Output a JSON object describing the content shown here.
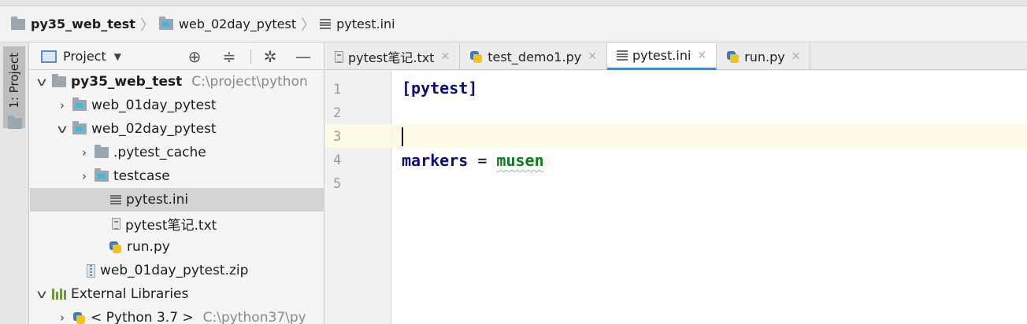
{
  "breadcrumb": [
    {
      "label": "py35_web_test",
      "icon": "folder-icon"
    },
    {
      "label": "web_02day_pytest",
      "icon": "module-folder-icon"
    },
    {
      "label": "pytest.ini",
      "icon": "ini-file-icon"
    }
  ],
  "left_strip": {
    "project_tab_label": "1: Project"
  },
  "project_panel": {
    "title": "Project"
  },
  "tree": [
    {
      "label": "py35_web_test",
      "path": "C:\\project\\python",
      "bold": true,
      "expanded": true,
      "icon": "folder-icon"
    },
    {
      "label": "web_01day_pytest",
      "expanded": false,
      "icon": "module-folder-icon"
    },
    {
      "label": "web_02day_pytest",
      "expanded": true,
      "icon": "module-folder-icon"
    },
    {
      "label": ".pytest_cache",
      "expanded": false,
      "icon": "folder-icon"
    },
    {
      "label": "testcase",
      "expanded": false,
      "icon": "module-folder-icon"
    },
    {
      "label": "pytest.ini",
      "icon": "ini-file-icon",
      "selected": true
    },
    {
      "label": "pytest笔记.txt",
      "icon": "text-file-icon"
    },
    {
      "label": "run.py",
      "icon": "python-file-icon"
    },
    {
      "label": "web_01day_pytest.zip",
      "icon": "zip-file-icon"
    },
    {
      "label": "External Libraries",
      "expanded": true,
      "icon": "library-icon"
    },
    {
      "label": "< Python 3.7 >",
      "path": "C:\\python37\\py",
      "expanded": false,
      "icon": "python-icon"
    }
  ],
  "tabs": [
    {
      "label": "pytest笔记.txt",
      "icon": "text-file-icon",
      "active": false
    },
    {
      "label": "test_demo1.py",
      "icon": "python-file-icon",
      "active": false
    },
    {
      "label": "pytest.ini",
      "icon": "ini-file-icon",
      "active": true
    },
    {
      "label": "run.py",
      "icon": "python-file-icon",
      "active": false
    }
  ],
  "editor": {
    "line_numbers": [
      "1",
      "2",
      "3",
      "4",
      "5"
    ],
    "current_line": 3,
    "code": {
      "line1": "[pytest]",
      "line4_key": "markers",
      "line4_eq": " = ",
      "line4_value": "musen"
    }
  },
  "colors": {
    "section": "#0a0a80",
    "value": "#067d17",
    "current_line_bg": "#fffae3",
    "selection_bg": "#d4d4d4"
  }
}
